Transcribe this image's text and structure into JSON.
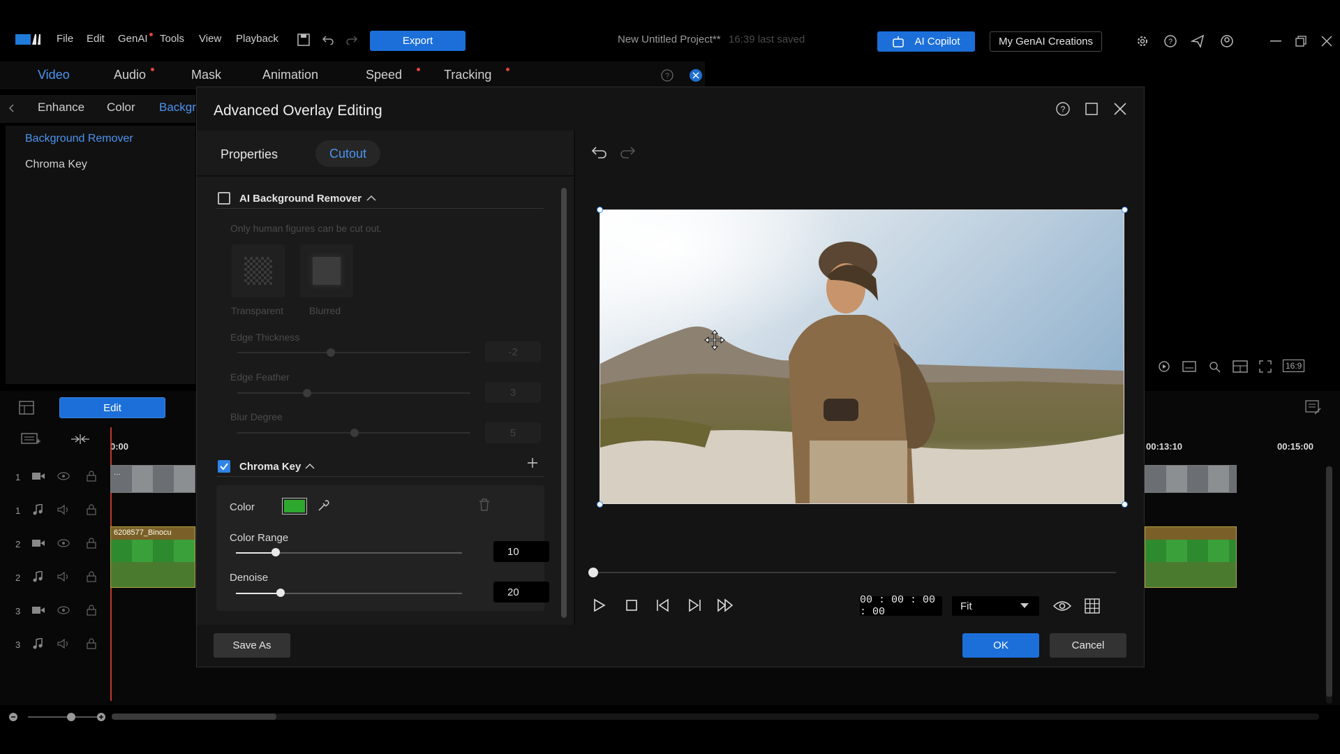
{
  "menu": {
    "file": "File",
    "edit": "Edit",
    "genai": "GenAI",
    "tools": "Tools",
    "view": "View",
    "playback": "Playback"
  },
  "export_label": "Export",
  "project_title": "New Untitled Project**",
  "last_saved": "16:39 last saved",
  "ai_copilot": "AI Copilot",
  "my_genai": "My GenAI Creations",
  "main_tabs": {
    "video": "Video",
    "audio": "Audio",
    "mask": "Mask",
    "animation": "Animation",
    "speed": "Speed",
    "tracking": "Tracking"
  },
  "sub_tabs": {
    "enhance": "Enhance",
    "color": "Color",
    "background": "Backgr"
  },
  "left_list": {
    "bg_remover": "Background Remover",
    "chroma": "Chroma Key"
  },
  "edit_button": "Edit",
  "timeline": {
    "t0": "0:00",
    "t1": "00:13:10",
    "t2": "00:15:00",
    "clip2": "6208577_Binocu",
    "clip1": "…"
  },
  "track_numbers": [
    "1",
    "1",
    "2",
    "2",
    "3",
    "3"
  ],
  "right_ratio": "16:9",
  "dialog": {
    "title": "Advanced Overlay Editing",
    "tab_properties": "Properties",
    "tab_cutout": "Cutout",
    "ai_bg_title": "AI Background Remover",
    "ai_bg_note": "Only human figures can be cut out.",
    "transparent": "Transparent",
    "blurred": "Blurred",
    "edge_thickness": "Edge Thickness",
    "edge_thickness_val": "-2",
    "edge_feather": "Edge Feather",
    "edge_feather_val": "3",
    "blur_degree": "Blur Degree",
    "blur_degree_val": "5",
    "chroma_title": "Chroma Key",
    "color_label": "Color",
    "chroma_color": "#2ea82e",
    "color_range": "Color Range",
    "color_range_val": "10",
    "denoise": "Denoise",
    "denoise_val": "20",
    "timecode": "00 : 00 : 00 : 00",
    "fit": "Fit",
    "save_as": "Save As",
    "ok": "OK",
    "cancel": "Cancel"
  },
  "accent": "#2f84e8"
}
